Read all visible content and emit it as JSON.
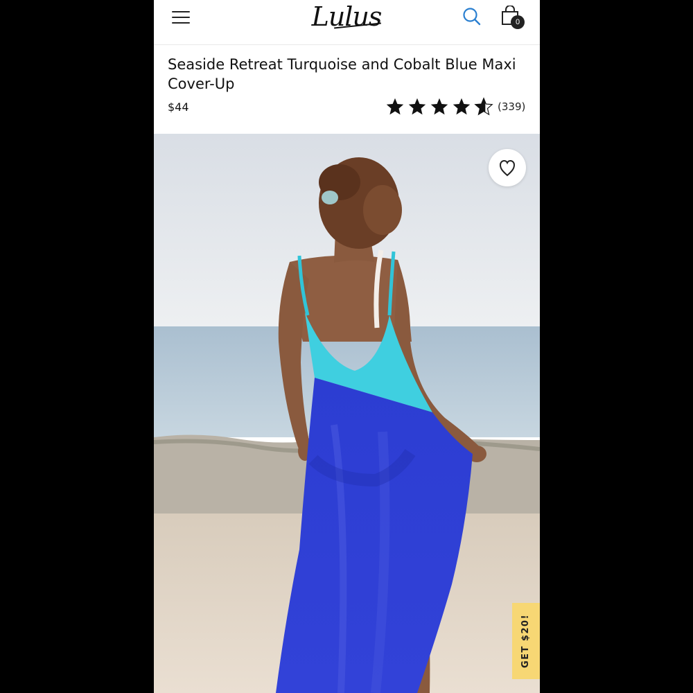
{
  "header": {
    "logo_text": "Lulus",
    "cart_count": "0"
  },
  "product": {
    "title": "Seaside Retreat Turquoise and Cobalt Blue Maxi Cover-Up",
    "price": "$44",
    "rating": {
      "stars": 4.5,
      "max": 5,
      "review_count": "(339)"
    },
    "image": {
      "subject": "model on beach wearing turquoise and cobalt blue maxi cover-up"
    }
  },
  "promo": {
    "label": "GET $20!"
  },
  "icons": {
    "menu": "hamburger-icon",
    "search": "search-icon",
    "cart": "shopping-bag-icon",
    "wishlist": "heart-icon",
    "star": "star-icon"
  },
  "colors": {
    "search_icon": "#2a7fd0",
    "promo_bg": "#f7d774",
    "dress_turquoise": "#3ccfe0",
    "dress_cobalt": "#2b3bd0"
  }
}
